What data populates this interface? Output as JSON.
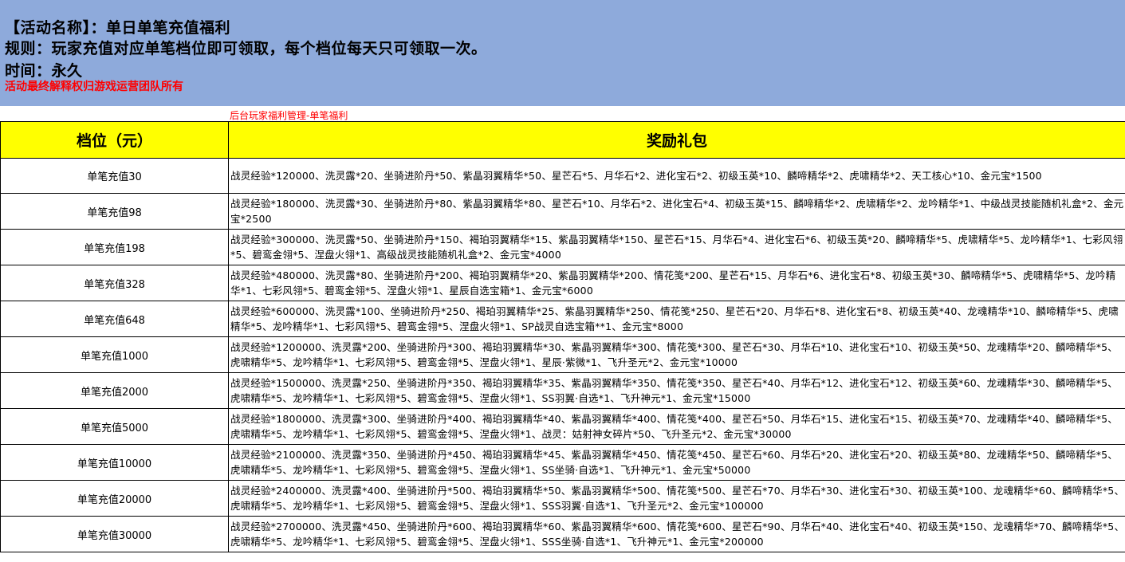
{
  "banner": {
    "name_line": "【活动名称】：单日单笔充值福利",
    "rule_line": "规则：玩家充值对应单笔档位即可领取，每个档位每天只可领取一次。",
    "time_line": "时间：永久",
    "disclaimer": "活动最终解释权归游戏运营团队所有"
  },
  "note": "后台玩家福利管理-单笔福利",
  "table": {
    "headers": [
      "档位（元）",
      "奖励礼包"
    ],
    "rows": [
      {
        "tier": "单笔充值30",
        "reward": "战灵经验*120000、洗灵露*20、坐骑进阶丹*50、紫晶羽翼精华*50、星芒石*5、月华石*2、进化宝石*2、初级玉英*10、麟啼精华*2、虎啸精华*2、天工核心*10、金元宝*1500"
      },
      {
        "tier": "单笔充值98",
        "reward": "战灵经验*180000、洗灵露*30、坐骑进阶丹*80、紫晶羽翼精华*80、星芒石*10、月华石*2、进化宝石*4、初级玉英*15、麟啼精华*2、虎啸精华*2、龙吟精华*1、中级战灵技能随机礼盒*2、金元宝*2500"
      },
      {
        "tier": "单笔充值198",
        "reward": "战灵经验*300000、洗灵露*50、坐骑进阶丹*150、褐珀羽翼精华*15、紫晶羽翼精华*150、星芒石*15、月华石*4、进化宝石*6、初级玉英*20、麟啼精华*5、虎啸精华*5、龙吟精华*1、七彩风翎*5、碧鸾金翎*5、涅盘火翎*1、高级战灵技能随机礼盒*2、金元宝*4000"
      },
      {
        "tier": "单笔充值328",
        "reward": "战灵经验*480000、洗灵露*80、坐骑进阶丹*200、褐珀羽翼精华*20、紫晶羽翼精华*200、情花笺*200、星芒石*15、月华石*6、进化宝石*8、初级玉英*30、麟啼精华*5、虎啸精华*5、龙吟精华*1、七彩风翎*5、碧鸾金翎*5、涅盘火翎*1、星辰自选宝箱*1、金元宝*6000"
      },
      {
        "tier": "单笔充值648",
        "reward": "战灵经验*600000、洗灵露*100、坐骑进阶丹*250、褐珀羽翼精华*25、紫晶羽翼精华*250、情花笺*250、星芒石*20、月华石*8、进化宝石*8、初级玉英*40、龙魂精华*10、麟啼精华*5、虎啸精华*5、龙吟精华*1、七彩风翎*5、碧鸾金翎*5、涅盘火翎*1、SP战灵自选宝箱**1、金元宝*8000"
      },
      {
        "tier": "单笔充值1000",
        "reward": "战灵经验*1200000、洗灵露*200、坐骑进阶丹*300、褐珀羽翼精华*30、紫晶羽翼精华*300、情花笺*300、星芒石*30、月华石*10、进化宝石*10、初级玉英*50、龙魂精华*20、麟啼精华*5、虎啸精华*5、龙吟精华*1、七彩风翎*5、碧鸾金翎*5、涅盘火翎*1、星辰·紫微*1、飞升圣元*2、金元宝*10000"
      },
      {
        "tier": "单笔充值2000",
        "reward": "战灵经验*1500000、洗灵露*250、坐骑进阶丹*350、褐珀羽翼精华*35、紫晶羽翼精华*350、情花笺*350、星芒石*40、月华石*12、进化宝石*12、初级玉英*60、龙魂精华*30、麟啼精华*5、虎啸精华*5、龙吟精华*1、七彩风翎*5、碧鸾金翎*5、涅盘火翎*1、SS羽翼·自选*1、飞升神元*1、金元宝*15000"
      },
      {
        "tier": "单笔充值5000",
        "reward": "战灵经验*1800000、洗灵露*300、坐骑进阶丹*400、褐珀羽翼精华*40、紫晶羽翼精华*400、情花笺*400、星芒石*50、月华石*15、进化宝石*15、初级玉英*70、龙魂精华*40、麟啼精华*5、虎啸精华*5、龙吟精华*1、七彩风翎*5、碧鸾金翎*5、涅盘火翎*1、战灵：姑射神女碎片*50、飞升圣元*2、金元宝*30000"
      },
      {
        "tier": "单笔充值10000",
        "reward": "战灵经验*2100000、洗灵露*350、坐骑进阶丹*450、褐珀羽翼精华*45、紫晶羽翼精华*450、情花笺*450、星芒石*60、月华石*20、进化宝石*20、初级玉英*80、龙魂精华*50、麟啼精华*5、虎啸精华*5、龙吟精华*1、七彩风翎*5、碧鸾金翎*5、涅盘火翎*1、SS坐骑·自选*1、飞升神元*1、金元宝*50000"
      },
      {
        "tier": "单笔充值20000",
        "reward": "战灵经验*2400000、洗灵露*400、坐骑进阶丹*500、褐珀羽翼精华*50、紫晶羽翼精华*500、情花笺*500、星芒石*70、月华石*30、进化宝石*30、初级玉英*100、龙魂精华*60、麟啼精华*5、虎啸精华*5、龙吟精华*1、七彩风翎*5、碧鸾金翎*5、涅盘火翎*1、SSS羽翼·自选*1、飞升圣元*2、金元宝*100000"
      },
      {
        "tier": "单笔充值30000",
        "reward": "战灵经验*2700000、洗灵露*450、坐骑进阶丹*600、褐珀羽翼精华*60、紫晶羽翼精华*600、情花笺*600、星芒石*90、月华石*40、进化宝石*40、初级玉英*150、龙魂精华*70、麟啼精华*5、虎啸精华*5、龙吟精华*1、七彩风翎*5、碧鸾金翎*5、涅盘火翎*1、SSS坐骑·自选*1、飞升神元*1、金元宝*200000"
      }
    ]
  }
}
